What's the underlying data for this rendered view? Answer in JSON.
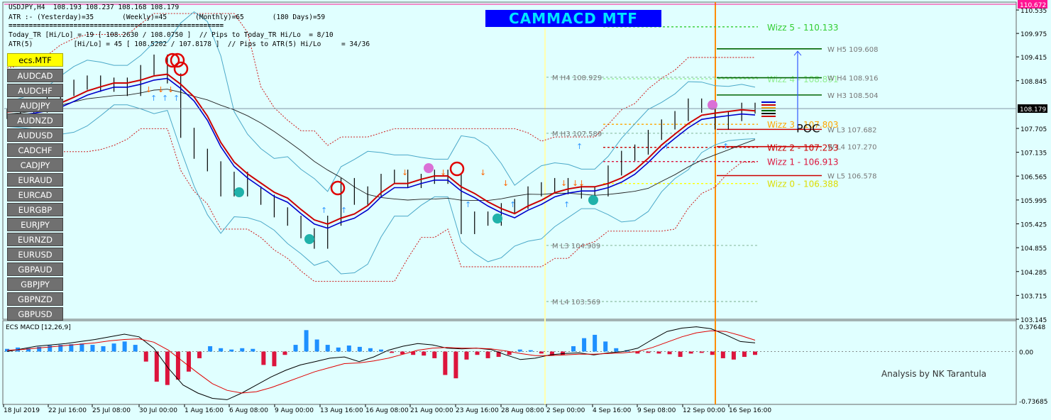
{
  "header": {
    "symbol_line": "USDJPY,H4  108.193 108.237 108.168 108.179",
    "atr_line": "ATR :- (Yesterday)=35       (Weekly)=45       (Monthly)=65       (180 Days)=59",
    "separator": "=====================================================",
    "today_line": "Today_TR [Hi/Lo] = 19 [ 108.2630 / 108.0750 ]  // Pips to Today_TR Hi/Lo  = 8/10",
    "atr5_line": "ATR(5)          [Hi/Lo] = 45 [ 108.5202 / 107.8178 ]  // Pips to ATR(5) Hi/Lo     = 34/36"
  },
  "banner": {
    "title": "CAMMACD MTF"
  },
  "symbols": {
    "active": "ecs.MTF",
    "items": [
      "AUDCAD",
      "AUDCHF",
      "AUDJPY",
      "AUDNZD",
      "AUDUSD",
      "CADCHF",
      "CADJPY",
      "EURAUD",
      "EURCAD",
      "EURGBP",
      "EURJPY",
      "EURNZD",
      "EURUSD",
      "GBPAUD",
      "GBPJPY",
      "GBPNZD",
      "GBPUSD"
    ]
  },
  "analysis": "Analysis by NK Tarantula",
  "colors": {
    "background": "#e0ffff",
    "up": "#000000",
    "ma_red": "#cc0000",
    "ma_blue": "#0000cc",
    "bands": "#4aa8c8",
    "vline": "#ff8c00",
    "hist_up": "#1e90ff",
    "hist_down": "#dc143c"
  },
  "chart_data": [
    {
      "type": "line",
      "price_axis": {
        "ylim": [
          103.145,
          110.672
        ],
        "ticks": [
          "110.672",
          "110.535",
          "109.975",
          "109.415",
          "108.845",
          "108.179",
          "107.705",
          "107.135",
          "106.565",
          "105.995",
          "105.425",
          "104.855",
          "104.285",
          "103.715",
          "103.145"
        ],
        "tick_values": [
          110.672,
          110.535,
          109.975,
          109.415,
          108.845,
          108.179,
          107.705,
          107.135,
          106.565,
          105.995,
          105.425,
          104.855,
          104.285,
          103.715,
          103.145
        ],
        "current_price": 108.179
      },
      "x_ticks": [
        "18 Jul 2019",
        "22 Jul 16:00",
        "25 Jul 08:00",
        "30 Jul 00:00",
        "1 Aug 16:00",
        "6 Aug 08:00",
        "9 Aug 00:00",
        "13 Aug 16:00",
        "16 Aug 08:00",
        "21 Aug 00:00",
        "23 Aug 16:00",
        "28 Aug 08:00",
        "2 Sep 00:00",
        "4 Sep 16:00",
        "9 Sep 08:00",
        "12 Sep 00:00",
        "16 Sep 16:00"
      ],
      "close": [
        108.05,
        108.1,
        108.2,
        108.35,
        108.6,
        108.75,
        108.85,
        108.7,
        108.8,
        108.6,
        109.1,
        109.35,
        108.9,
        107.6,
        107.1,
        106.8,
        106.2,
        106.55,
        106.2,
        106.0,
        105.7,
        105.5,
        105.2,
        104.95,
        105.5,
        106.4,
        106.0,
        106.2,
        106.5,
        106.6,
        106.4,
        106.5,
        106.6,
        106.5,
        105.3,
        105.6,
        105.5,
        105.8,
        105.9,
        106.2,
        106.3,
        106.4,
        106.25,
        106.15,
        106.2,
        106.7,
        107.05,
        107.2,
        107.55,
        107.8,
        108.0,
        108.3,
        108.2,
        107.8,
        108.0,
        108.2,
        108.179
      ],
      "levels": [
        {
          "label": "Wizz 5 - 110.133",
          "value": 110.133,
          "color": "#32cd32"
        },
        {
          "label": "W  H5 109.608",
          "value": 109.608,
          "color": "#006400"
        },
        {
          "label": "Wizz 4 - 108.891",
          "value": 108.891,
          "color": "#90ee90"
        },
        {
          "label": "M  H4 108.929",
          "value": 108.929,
          "color": "#9cc9b4"
        },
        {
          "label": "W  H4 108.916",
          "value": 108.916,
          "color": "#006400"
        },
        {
          "label": "W  H3 108.504",
          "value": 108.504,
          "color": "#006400"
        },
        {
          "label": "Wizz 3 - 107.803",
          "value": 107.803,
          "color": "#ffa500"
        },
        {
          "label": "W  L3 107.682",
          "value": 107.682,
          "color": "#cc0000"
        },
        {
          "label": "M  H3 107.589",
          "value": 107.589,
          "color": "#9cc9b4"
        },
        {
          "label": "Wizz 2 - 107.253",
          "value": 107.253,
          "color": "#cc0000"
        },
        {
          "label": "W  L4 107.270",
          "value": 107.27,
          "color": "#cc0000"
        },
        {
          "label": "Wizz 1 - 106.913",
          "value": 106.913,
          "color": "#dc143c"
        },
        {
          "label": "W  L5 106.578",
          "value": 106.578,
          "color": "#cc0000"
        },
        {
          "label": "Wizz 0 - 106.388",
          "value": 106.388,
          "color": "#ffff00"
        },
        {
          "label": "M  L3 104.909",
          "value": 104.909,
          "color": "#9cc9b4"
        },
        {
          "label": "M  L4 103.569",
          "value": 103.569,
          "color": "#9cc9b4"
        }
      ],
      "poc": {
        "label": "POC",
        "value": 107.75
      }
    },
    {
      "type": "bar",
      "title": "ECS MACD [12,26,9]",
      "ylim": [
        -0.73685,
        0.37648
      ],
      "ticks": [
        "0.37648",
        "0.00",
        "-0.73685"
      ],
      "tick_values": [
        0.37648,
        0.0,
        -0.73685
      ],
      "histogram": [
        0.04,
        0.06,
        0.05,
        0.07,
        0.09,
        0.1,
        0.11,
        0.12,
        0.1,
        0.08,
        0.12,
        0.15,
        0.1,
        -0.15,
        -0.45,
        -0.5,
        -0.42,
        -0.3,
        -0.1,
        0.08,
        0.05,
        0.03,
        0.05,
        0.04,
        -0.2,
        -0.22,
        -0.05,
        0.1,
        0.32,
        0.18,
        0.1,
        0.06,
        0.09,
        0.07,
        0.05,
        0.03,
        -0.02,
        -0.04,
        -0.05,
        -0.06,
        -0.1,
        -0.35,
        -0.4,
        -0.12,
        -0.05,
        -0.1,
        -0.08,
        -0.05,
        0.03,
        0.02,
        -0.03,
        -0.06,
        -0.05,
        0.08,
        0.2,
        0.25,
        0.15,
        0.05,
        0.02,
        -0.03,
        -0.02,
        -0.03,
        -0.04,
        -0.08,
        -0.03,
        -0.02,
        -0.05,
        -0.1,
        -0.12,
        -0.08,
        -0.05
      ],
      "macd": [
        0.0,
        0.04,
        0.08,
        0.1,
        0.12,
        0.15,
        0.18,
        0.22,
        0.26,
        0.22,
        0.05,
        -0.25,
        -0.5,
        -0.62,
        -0.7,
        -0.72,
        -0.62,
        -0.5,
        -0.38,
        -0.28,
        -0.2,
        -0.15,
        -0.1,
        -0.08,
        -0.15,
        -0.08,
        0.02,
        0.08,
        0.12,
        0.1,
        0.05,
        0.04,
        0.05,
        0.03,
        -0.05,
        -0.12,
        -0.1,
        -0.05,
        -0.03,
        -0.02,
        -0.05,
        -0.02,
        0.0,
        0.05,
        0.18,
        0.3,
        0.35,
        0.37,
        0.34,
        0.25,
        0.15,
        0.13
      ],
      "signal": [
        0.02,
        0.03,
        0.05,
        0.07,
        0.09,
        0.11,
        0.13,
        0.16,
        0.18,
        0.19,
        0.14,
        0.02,
        -0.15,
        -0.32,
        -0.48,
        -0.58,
        -0.62,
        -0.6,
        -0.54,
        -0.46,
        -0.38,
        -0.3,
        -0.24,
        -0.18,
        -0.17,
        -0.14,
        -0.1,
        -0.04,
        0.02,
        0.05,
        0.06,
        0.05,
        0.05,
        0.04,
        0.01,
        -0.03,
        -0.06,
        -0.06,
        -0.05,
        -0.04,
        -0.04,
        -0.03,
        -0.02,
        0.0,
        0.06,
        0.14,
        0.22,
        0.28,
        0.31,
        0.3,
        0.24,
        0.17
      ]
    }
  ]
}
